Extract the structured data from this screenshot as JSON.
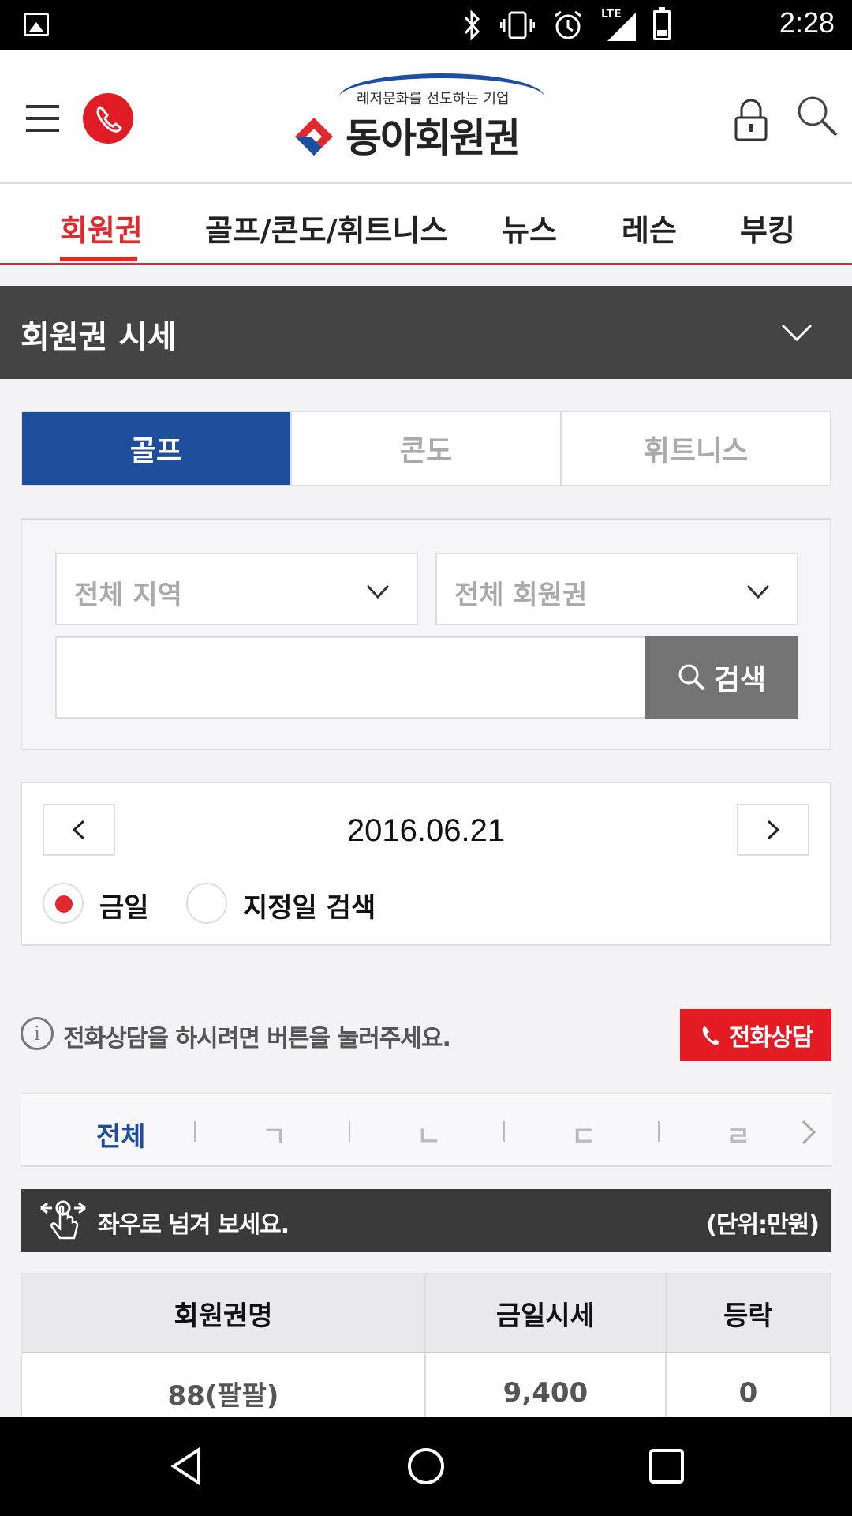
{
  "status_bar": {
    "time": "2:28",
    "network": "LTE",
    "icons": [
      "gallery-icon",
      "bluetooth-icon",
      "vibrate-icon",
      "alarm-icon",
      "signal-icon",
      "battery-icon"
    ]
  },
  "header": {
    "logo_subtitle": "레저문화를 선도하는 기업",
    "logo_title": "동아회원권",
    "icons": [
      "hamburger-menu-icon",
      "phone-icon",
      "lock-icon",
      "search-icon"
    ]
  },
  "nav": {
    "items": [
      {
        "label": "회원권",
        "active": true
      },
      {
        "label": "골프/콘도/휘트니스",
        "active": false
      },
      {
        "label": "뉴스",
        "active": false
      },
      {
        "label": "레슨",
        "active": false
      },
      {
        "label": "부킹",
        "active": false
      }
    ]
  },
  "section": {
    "title": "회원권 시세"
  },
  "category_tabs": [
    {
      "label": "골프",
      "active": true
    },
    {
      "label": "콘도",
      "active": false
    },
    {
      "label": "휘트니스",
      "active": false
    }
  ],
  "search": {
    "region_placeholder": "전체 지역",
    "membership_placeholder": "전체 회원권",
    "keyword_value": "",
    "button_label": "검색"
  },
  "date": {
    "value": "2016.06.21",
    "radio_today": "금일",
    "radio_custom": "지정일 검색",
    "selected": "금일"
  },
  "info": {
    "text": "전화상담을 하시려면 버튼을 눌러주세요.",
    "call_button": "전화상담"
  },
  "index_tabs": [
    {
      "label": "전체",
      "active": true
    },
    {
      "label": "ㄱ",
      "active": false
    },
    {
      "label": "ㄴ",
      "active": false
    },
    {
      "label": "ㄷ",
      "active": false
    },
    {
      "label": "ㄹ",
      "active": false
    }
  ],
  "hint": {
    "message": "좌우로 넘겨 보세요.",
    "unit": "(단위:만원)"
  },
  "table": {
    "headers": [
      "회원권명",
      "금일시세",
      "등락"
    ],
    "rows": [
      [
        "88(팔팔)",
        "9,400",
        "0"
      ]
    ]
  },
  "colors": {
    "accent_red": "#e0292f",
    "brand_blue": "#1f4e9c",
    "section_dark": "#444444"
  }
}
